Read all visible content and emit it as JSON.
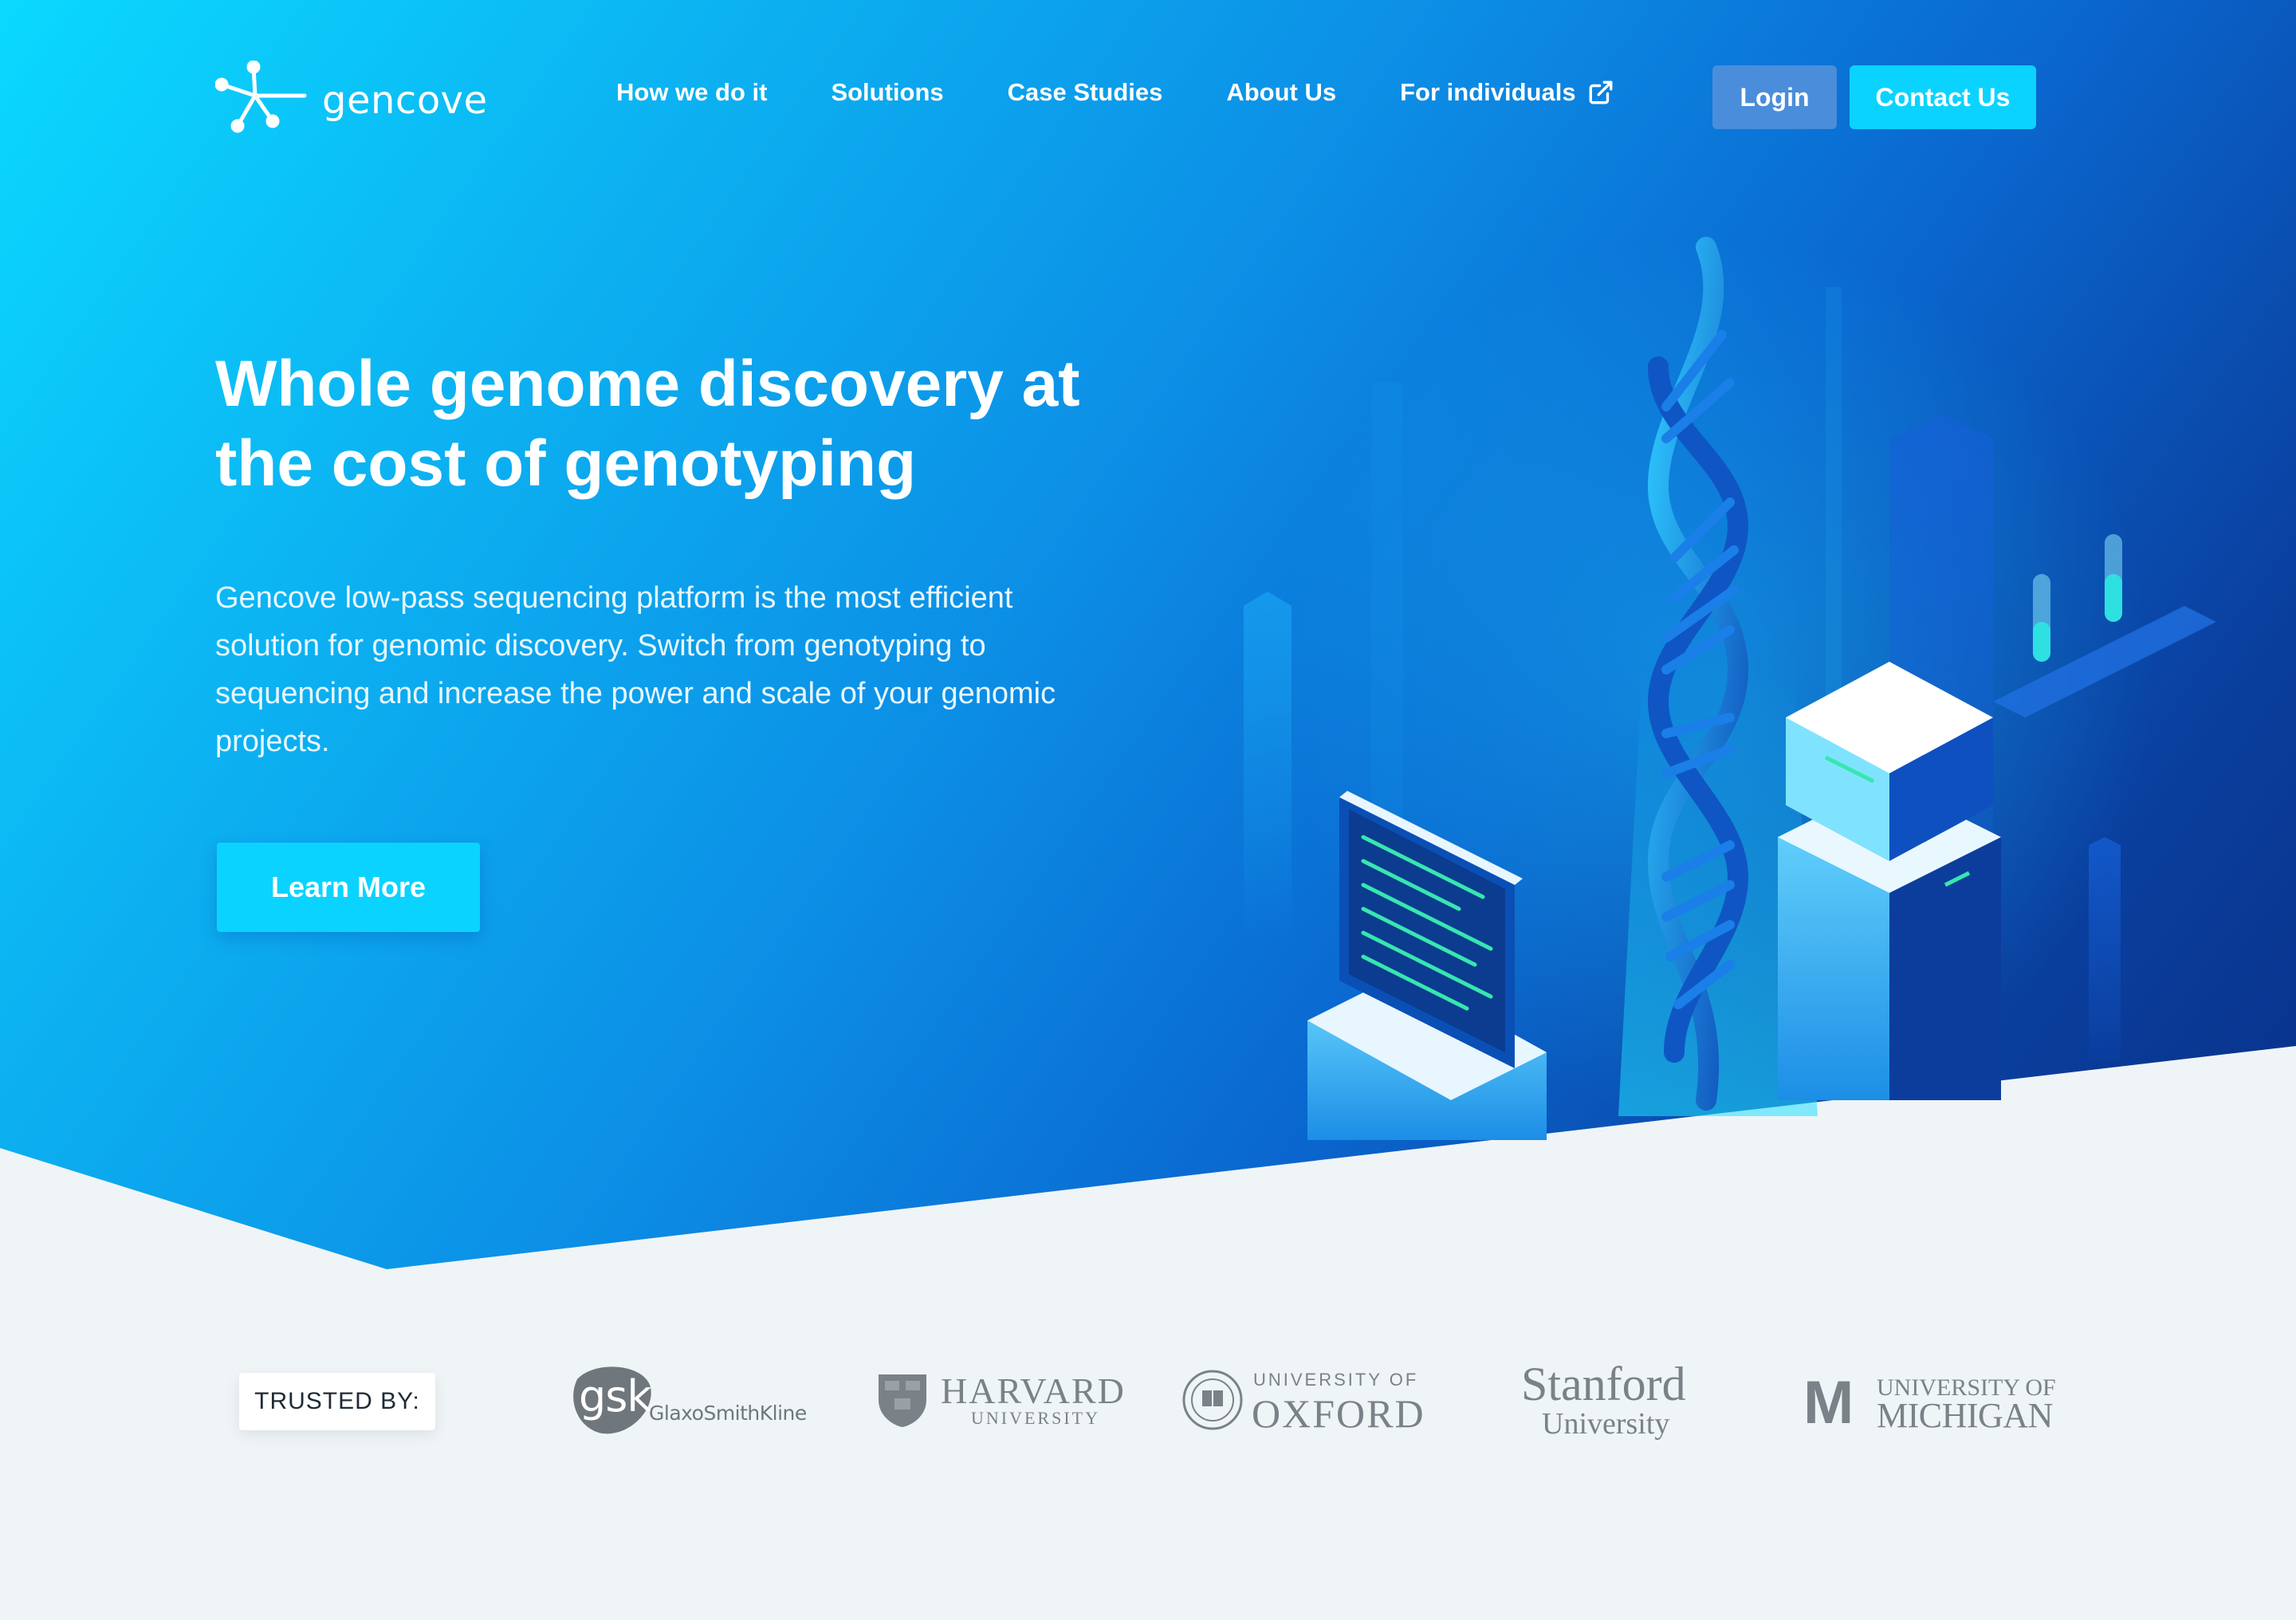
{
  "brand": {
    "name": "gencove",
    "logo_icon": "molecule-node-icon"
  },
  "nav": {
    "links": [
      {
        "label": "How we do it"
      },
      {
        "label": "Solutions"
      },
      {
        "label": "Case Studies"
      },
      {
        "label": "About Us"
      },
      {
        "label": "For individuals",
        "icon": "external-link-icon"
      }
    ],
    "login_label": "Login",
    "contact_label": "Contact Us"
  },
  "hero": {
    "headline_line1": "Whole genome discovery at",
    "headline_line2": "the cost of genotyping",
    "description": "Gencove low-pass sequencing platform is the most efficient solution for genomic discovery. Switch from genotyping to sequencing and increase the power and scale of your genomic projects.",
    "cta_label": "Learn More",
    "illustration": "dna-lab-isometric-illustration"
  },
  "trusted": {
    "label": "TRUSTED BY:",
    "logos": [
      {
        "mark": "gsk",
        "name": "GlaxoSmithKline"
      },
      {
        "name": "HARVARD",
        "sub": "UNIVERSITY"
      },
      {
        "top": "UNIVERSITY OF",
        "name": "OXFORD"
      },
      {
        "name": "Stanford",
        "sub": "University"
      },
      {
        "mark": "M",
        "top": "UNIVERSITY OF",
        "name": "MICHIGAN"
      }
    ]
  },
  "colors": {
    "hero_start": "#0ad9ff",
    "hero_end": "#082f86",
    "accent": "#0bd3ff",
    "login_bg": "#4a8ddb",
    "section_bg": "#eff4f7",
    "logo_gray": "#7a8288"
  }
}
